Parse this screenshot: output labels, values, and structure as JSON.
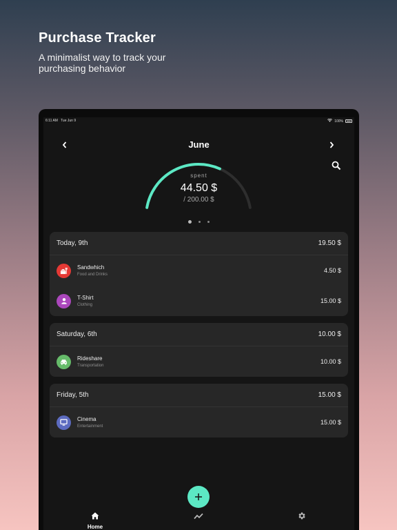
{
  "promo": {
    "title": "Purchase Tracker",
    "subtitle": "A minimalist way to track your purchasing behavior"
  },
  "statusbar": {
    "time": "6:11 AM",
    "date": "Tue Jun 9",
    "battery": "100%"
  },
  "header": {
    "month": "June",
    "prev_icon": "chevron-left-icon",
    "next_icon": "chevron-right-icon",
    "search_icon": "search-icon"
  },
  "gauge": {
    "label": "spent",
    "value": "44.50 $",
    "total": "/ 200.00 $",
    "spent_amount": 44.5,
    "budget_amount": 200,
    "accent": "#5ce8c4"
  },
  "pager": {
    "pages": 3,
    "active": 0
  },
  "groups": [
    {
      "date": "Today, 9th",
      "total": "19.50 $",
      "items": [
        {
          "name": "Sandwhich",
          "category": "Food and Drinks",
          "amount": "4.50 $",
          "icon": "food-icon",
          "color": "#e53935"
        },
        {
          "name": "T-Shirt",
          "category": "Clothing",
          "amount": "15.00 $",
          "icon": "person-icon",
          "color": "#ab47bc"
        }
      ]
    },
    {
      "date": "Saturday, 6th",
      "total": "10.00 $",
      "items": [
        {
          "name": "Rideshare",
          "category": "Transportation",
          "amount": "10.00 $",
          "icon": "car-icon",
          "color": "#66bb6a"
        }
      ]
    },
    {
      "date": "Friday, 5th",
      "total": "15.00 $",
      "items": [
        {
          "name": "Cinema",
          "category": "Entertainment",
          "amount": "15.00 $",
          "icon": "tv-icon",
          "color": "#5c6bc0"
        }
      ]
    }
  ],
  "fab": {
    "label": "+"
  },
  "tabs": [
    {
      "label": "Home",
      "icon": "home-icon"
    },
    {
      "label": "",
      "icon": "chart-icon"
    },
    {
      "label": "",
      "icon": "gear-icon"
    }
  ]
}
